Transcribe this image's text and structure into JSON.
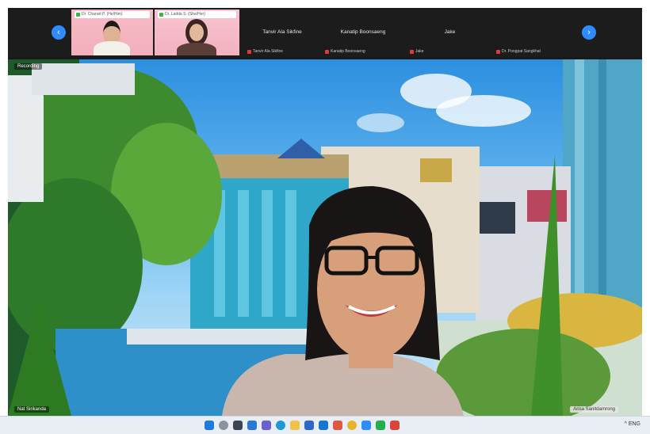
{
  "gallery": {
    "prev_icon": "chevron-left-icon",
    "next_icon": "chevron-right-icon",
    "tiles": [
      {
        "tag": "Dr. Chanvit P. (He/Him)",
        "subtitle": ""
      },
      {
        "tag": "Dr. Ladda S. (She/Her)",
        "subtitle": ""
      },
      {
        "name": "Tanvir Ala Sikfine",
        "subtitle": "Tanvir Ala Sikfine"
      },
      {
        "name": "Kanatip Boonsaeng",
        "subtitle": "Kanatip Boonsaeng"
      },
      {
        "name": "Jake",
        "subtitle": "Jake"
      },
      {
        "name": "",
        "subtitle": "Dr. Pongpat Sangkhat"
      }
    ]
  },
  "video": {
    "top_label": "Recording",
    "bottom_label": "Nat Sirikanda",
    "self_label": "Arisa Sanitdamrong"
  },
  "taskbar": {
    "icons": [
      "windows-icon",
      "search-icon",
      "task-view-icon",
      "widgets-icon",
      "chat-icon",
      "edge-icon",
      "explorer-icon",
      "store-icon",
      "mail-icon",
      "office-icon",
      "chrome-icon",
      "zoom-icon",
      "line-icon",
      "camera-icon"
    ],
    "tray_text": "^ ENG"
  },
  "colors": {
    "accent": "#2d8cff",
    "tile_pink": "#f4b3c1",
    "muted_red": "#e03b3b"
  }
}
